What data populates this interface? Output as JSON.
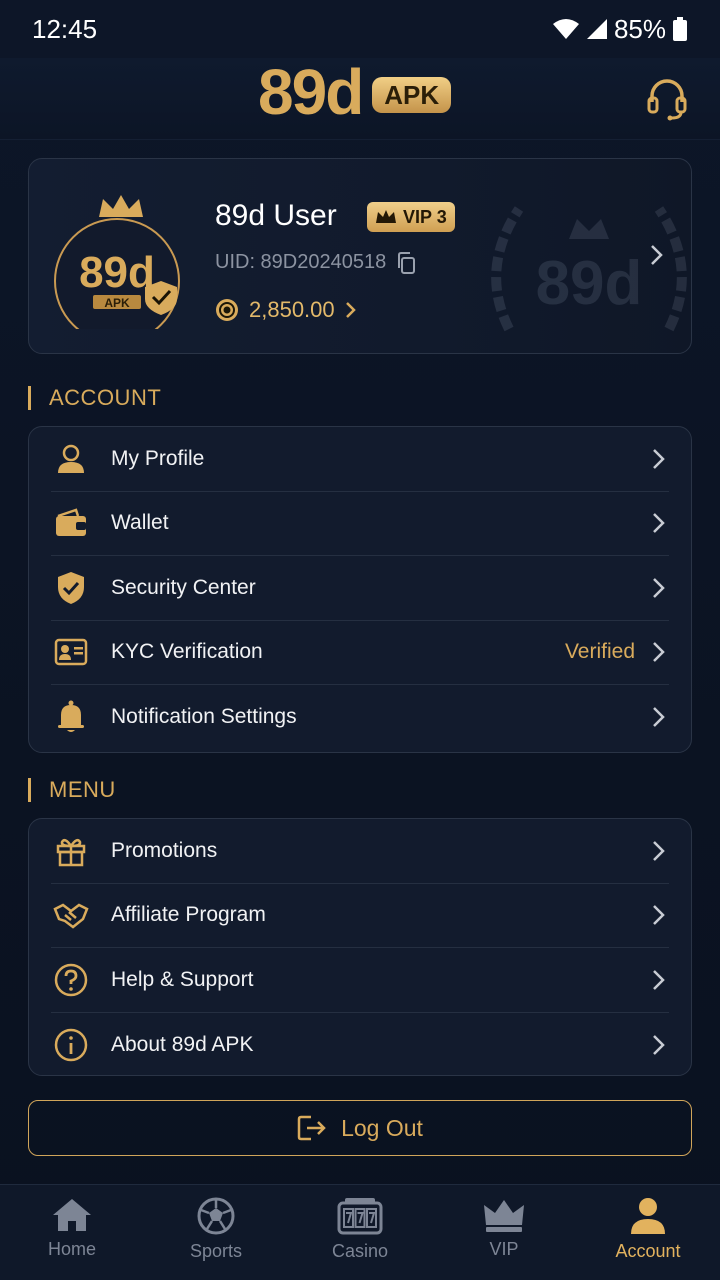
{
  "status": {
    "time": "12:45",
    "battery": "85%"
  },
  "header": {
    "logo_text": "89d",
    "logo_badge": "APK"
  },
  "profile": {
    "name": "89d User",
    "vip": "VIP 3",
    "uid": "UID: 89D20240518",
    "balance": "2,850.00",
    "avatar_text": "89d",
    "avatar_sub": "APK"
  },
  "account_section": {
    "title": "ACCOUNT",
    "items": [
      {
        "label": "My Profile",
        "icon": "user-icon",
        "value": ""
      },
      {
        "label": "Wallet",
        "icon": "wallet-icon",
        "value": ""
      },
      {
        "label": "Security Center",
        "icon": "shield-check-icon",
        "value": ""
      },
      {
        "label": "KYC Verification",
        "icon": "id-card-icon",
        "value": "Verified"
      },
      {
        "label": "Notification Settings",
        "icon": "bell-icon",
        "value": ""
      }
    ]
  },
  "menu_section": {
    "title": "MENU",
    "items": [
      {
        "label": "Promotions",
        "icon": "gift-icon"
      },
      {
        "label": "Affiliate Program",
        "icon": "handshake-icon"
      },
      {
        "label": "Help & Support",
        "icon": "question-icon"
      },
      {
        "label": "About 89d APK",
        "icon": "info-icon"
      }
    ]
  },
  "logout": {
    "label": "Log Out"
  },
  "nav": {
    "items": [
      {
        "label": "Home",
        "icon": "home-icon",
        "active": false
      },
      {
        "label": "Sports",
        "icon": "soccer-ball-icon",
        "active": false
      },
      {
        "label": "Casino",
        "icon": "slot-machine-icon",
        "active": false
      },
      {
        "label": "VIP",
        "icon": "crown-icon",
        "active": false
      },
      {
        "label": "Account",
        "icon": "account-icon",
        "active": true
      }
    ]
  },
  "colors": {
    "accent": "#d9ab5c",
    "background": "#0b1322",
    "card": "#121b2d"
  }
}
